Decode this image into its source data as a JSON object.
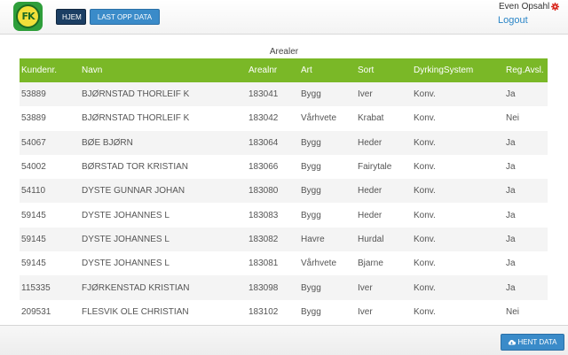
{
  "header": {
    "logo_text": "FK",
    "nav": {
      "home": "HJEM",
      "upload": "LAST OPP DATA"
    },
    "user_name": "Even Opsahl",
    "logout": "Logout"
  },
  "table": {
    "caption": "Arealer",
    "columns": [
      "Kundenr.",
      "Navn",
      "Arealnr",
      "Art",
      "Sort",
      "DyrkingSystem",
      "Reg.Avsl."
    ],
    "rows": [
      [
        "53889",
        "BJØRNSTAD THORLEIF K",
        "183041",
        "Bygg",
        "Iver",
        "Konv.",
        "Ja"
      ],
      [
        "53889",
        "BJØRNSTAD THORLEIF K",
        "183042",
        "Vårhvete",
        "Krabat",
        "Konv.",
        "Nei"
      ],
      [
        "54067",
        "BØE BJØRN",
        "183064",
        "Bygg",
        "Heder",
        "Konv.",
        "Ja"
      ],
      [
        "54002",
        "BØRSTAD TOR KRISTIAN",
        "183066",
        "Bygg",
        "Fairytale",
        "Konv.",
        "Ja"
      ],
      [
        "54110",
        "DYSTE GUNNAR JOHAN",
        "183080",
        "Bygg",
        "Heder",
        "Konv.",
        "Ja"
      ],
      [
        "59145",
        "DYSTE JOHANNES L",
        "183083",
        "Bygg",
        "Heder",
        "Konv.",
        "Ja"
      ],
      [
        "59145",
        "DYSTE JOHANNES L",
        "183082",
        "Havre",
        "Hurdal",
        "Konv.",
        "Ja"
      ],
      [
        "59145",
        "DYSTE JOHANNES L",
        "183081",
        "Vårhvete",
        "Bjarne",
        "Konv.",
        "Ja"
      ],
      [
        "115335",
        "FJØRKENSTAD KRISTIAN",
        "183098",
        "Bygg",
        "Iver",
        "Konv.",
        "Ja"
      ],
      [
        "209531",
        "FLESVIK OLE CHRISTIAN",
        "183102",
        "Bygg",
        "Iver",
        "Konv.",
        "Nei"
      ]
    ]
  },
  "footer": {
    "fetch_button": "HENT DATA"
  },
  "colors": {
    "header_green": "#7ab827",
    "button_blue": "#3a8bc9",
    "home_navy": "#1b3e63",
    "gear_red": "#d9261c"
  },
  "icons": {
    "gear": "gear-icon",
    "cloud_download": "cloud-download-icon"
  }
}
